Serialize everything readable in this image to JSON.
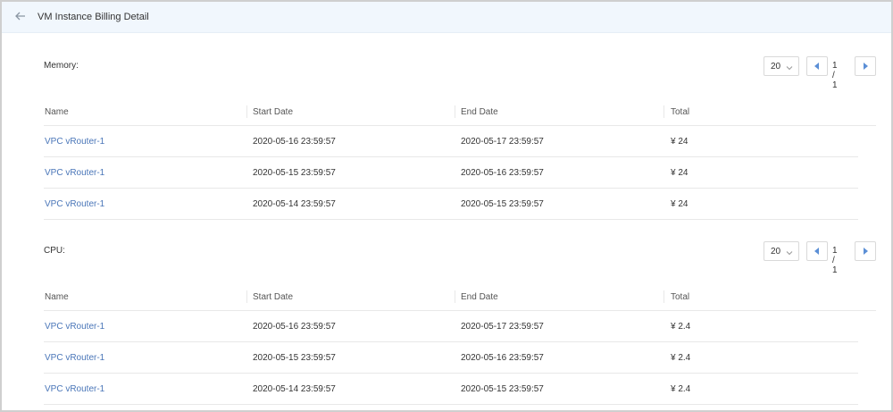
{
  "header": {
    "title": "VM Instance Billing Detail"
  },
  "columns": [
    "Name",
    "Start Date",
    "End Date",
    "Total"
  ],
  "sections": [
    {
      "title": "Memory:",
      "pager": {
        "page_size": "20",
        "page_indicator": "1 / 1"
      },
      "rows": [
        {
          "name": "VPC vRouter-1",
          "start": "2020-05-16 23:59:57",
          "end": "2020-05-17 23:59:57",
          "total": "¥ 24"
        },
        {
          "name": "VPC vRouter-1",
          "start": "2020-05-15 23:59:57",
          "end": "2020-05-16 23:59:57",
          "total": "¥ 24"
        },
        {
          "name": "VPC vRouter-1",
          "start": "2020-05-14 23:59:57",
          "end": "2020-05-15 23:59:57",
          "total": "¥ 24"
        }
      ]
    },
    {
      "title": "CPU:",
      "pager": {
        "page_size": "20",
        "page_indicator": "1 / 1"
      },
      "rows": [
        {
          "name": "VPC vRouter-1",
          "start": "2020-05-16 23:59:57",
          "end": "2020-05-17 23:59:57",
          "total": "¥ 2.4"
        },
        {
          "name": "VPC vRouter-1",
          "start": "2020-05-15 23:59:57",
          "end": "2020-05-16 23:59:57",
          "total": "¥ 2.4"
        },
        {
          "name": "VPC vRouter-1",
          "start": "2020-05-14 23:59:57",
          "end": "2020-05-15 23:59:57",
          "total": "¥ 2.4"
        }
      ]
    }
  ],
  "colors": {
    "header_bg": "#f1f7fd",
    "link": "#4a76b8",
    "pager_arrow": "#5b8fd6"
  },
  "icons": {
    "back": "arrow-left-icon",
    "select": "chevron-down-icon",
    "prev": "caret-left-icon",
    "next": "caret-right-icon"
  }
}
